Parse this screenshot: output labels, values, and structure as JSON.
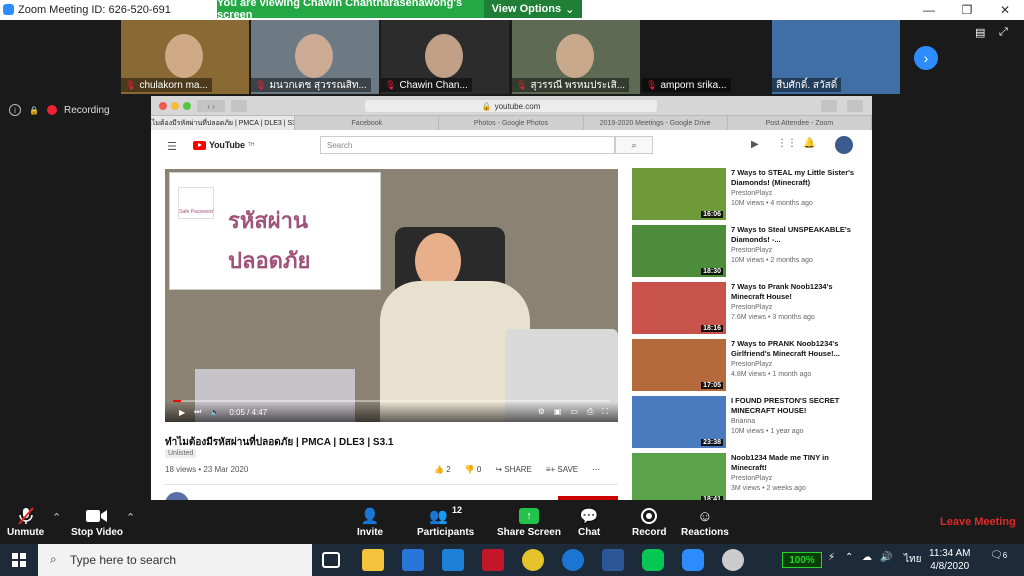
{
  "window": {
    "title": "Zoom Meeting ID: 626-520-691",
    "banner": "You are viewing Chawin Chantharasenawong's screen",
    "view_options": "View Options"
  },
  "gallery": [
    {
      "name": "chulakorn ma...",
      "color": "#8a6a34"
    },
    {
      "name": "มนวกเตช สุวรรณสิท...",
      "color": "#6d7a84"
    },
    {
      "name": "Chawin Chan...",
      "color": "#2c2c2c"
    },
    {
      "name": "สุวรรณี พรหมประเสิ...",
      "color": "#5e6a54"
    },
    {
      "name": "amporn srika...",
      "color": "#1a1a1a"
    },
    {
      "name": "สืบศักดิ์. สวัสดิ์",
      "color": "#3f6fa5"
    }
  ],
  "status": {
    "recording": "Recording"
  },
  "browser": {
    "url": "youtube.com",
    "tabs": [
      {
        "label": "ทำไมต้องมีรหัสผ่านที่ปลอดภัย | PMCA | DLE3 | S3...",
        "active": true
      },
      {
        "label": "Facebook",
        "active": false
      },
      {
        "label": "Photos - Google Photos",
        "active": false
      },
      {
        "label": "2019-2020 Meetings - Google Drive",
        "active": false
      },
      {
        "label": "Post Attendee - Zoom",
        "active": false
      }
    ]
  },
  "youtube": {
    "logo": "YouTube",
    "logo_sup": "TH",
    "search_placeholder": "Search",
    "video": {
      "slide_line1": "รหัสผ่าน",
      "slide_line2": "ปลอดภัย",
      "slide_badge": "Safe Password",
      "time": "0:05 / 4:47",
      "progress": 0.018,
      "title": "ทำไมต้องมีรหัสผ่านที่ปลอดภัย | PMCA | DLE3 | S3.1",
      "unlisted": "Unlisted",
      "stats": "18 views • 23 Mar 2020",
      "likes": "2",
      "dislikes": "0",
      "share": "SHARE",
      "save": "SAVE"
    },
    "recommended": [
      {
        "title": "7 Ways to STEAL my Little Sister's Diamonds! (Minecraft)",
        "channel": "PrestonPlayz",
        "meta": "10M views • 4 months ago",
        "duration": "16:06",
        "color": "#6f9a3a"
      },
      {
        "title": "7 Ways to Steal UNSPEAKABLE's Diamonds! -...",
        "channel": "PrestonPlayz",
        "meta": "10M views • 2 months ago",
        "duration": "18:30",
        "color": "#4d8c3b"
      },
      {
        "title": "7 Ways to Prank Noob1234's Minecraft House!",
        "channel": "PrestonPlayz",
        "meta": "7.6M views • 3 months ago",
        "duration": "18:16",
        "color": "#c8534a"
      },
      {
        "title": "7 Ways to PRANK Noob1234's Girlfriend's Minecraft House!...",
        "channel": "PrestonPlayz",
        "meta": "4.8M views • 1 month ago",
        "duration": "17:05",
        "color": "#b46a3c"
      },
      {
        "title": "I FOUND PRESTON'S SECRET MINECRAFT HOUSE!",
        "channel": "Brianna",
        "meta": "10M views • 1 year ago",
        "duration": "23:38",
        "color": "#4a7bbf"
      },
      {
        "title": "Noob1234 Made me TINY in Minecraft!",
        "channel": "PrestonPlayz",
        "meta": "3M views • 2 weeks ago",
        "duration": "18:41",
        "color": "#5aa34a"
      }
    ]
  },
  "toolbar": {
    "unmute": "Unmute",
    "stop_video": "Stop Video",
    "invite": "Invite",
    "participants": "Participants",
    "participants_count": "12",
    "share_screen": "Share Screen",
    "chat": "Chat",
    "record": "Record",
    "reactions": "Reactions",
    "leave": "Leave Meeting"
  },
  "taskbar": {
    "search_placeholder": "Type here to search",
    "battery": "100%",
    "lang": "ไทย",
    "time": "11:34 AM",
    "date": "4/8/2020",
    "notifications": "6"
  },
  "colors": {
    "zoom_blue": "#2d8cff",
    "banner_green": "#23a843",
    "leave_red": "#e02828",
    "yt_red": "#ff0000"
  }
}
